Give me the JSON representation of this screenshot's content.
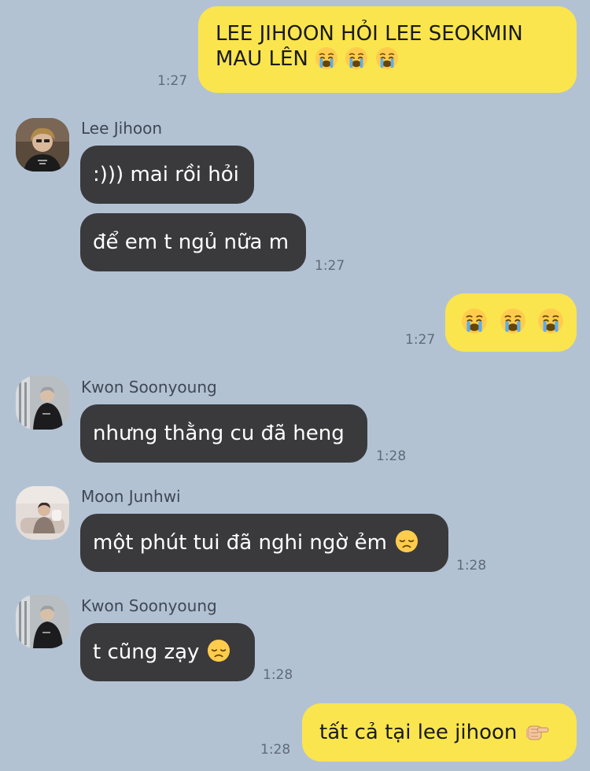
{
  "messages": {
    "m1": {
      "line1": "LEE JIHOON HỎI LEE SEOKMIN",
      "line2": "MAU LÊN",
      "time": "1:27",
      "emoji": [
        "crying-face-emoji",
        "crying-face-emoji",
        "crying-face-emoji"
      ]
    },
    "m2": {
      "sender": "Lee Jihoon",
      "text": ":))) mai rồi hỏi"
    },
    "m3": {
      "text": "để em t ngủ nữa m",
      "time": "1:27"
    },
    "m4": {
      "time": "1:27",
      "emoji": [
        "crying-face-emoji",
        "crying-face-emoji",
        "crying-face-emoji"
      ]
    },
    "m5": {
      "sender": "Kwon Soonyoung",
      "text": "nhưng thằng cu đã heng",
      "time": "1:28"
    },
    "m6": {
      "sender": "Moon Junhwi",
      "text": "một phút tui đã nghi ngờ ẻm",
      "time": "1:28",
      "emoji": "disappointed-face-emoji"
    },
    "m7": {
      "sender": "Kwon Soonyoung",
      "text": "t cũng zạy",
      "time": "1:28",
      "emoji": "disappointed-face-emoji"
    },
    "m8": {
      "text": "tất cả tại lee jihoon",
      "time": "1:28",
      "emoji": "backhand-index-pointing-right-emoji"
    }
  },
  "colors": {
    "background": "#b3c2d3",
    "outgoing_bubble": "#fae54e",
    "incoming_bubble": "#3a3a3c"
  }
}
